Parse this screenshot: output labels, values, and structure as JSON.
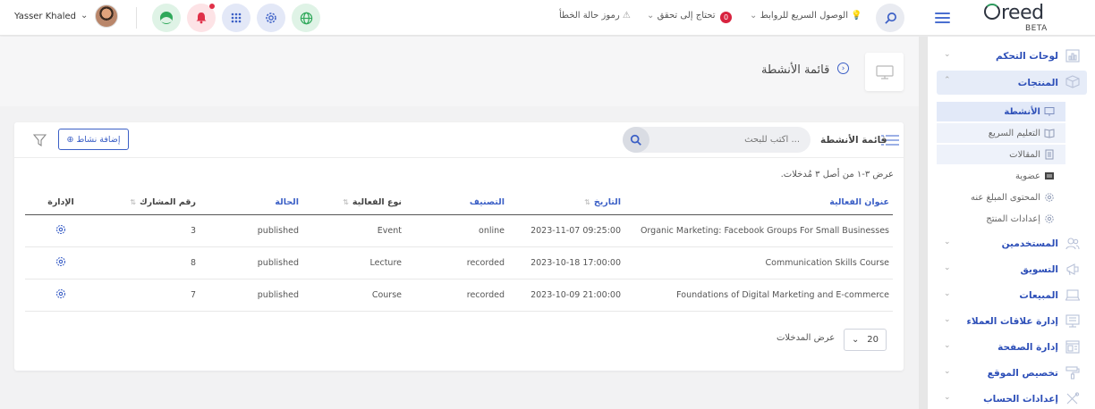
{
  "topbar": {
    "user_name": "Yasser Khaled",
    "quick_access": "الوصول السريع للروابط",
    "needs_check": "تحتاج إلى تحقق",
    "needs_check_count": "0",
    "error_codes": "رموز حالة الخطأ",
    "logo": "reed",
    "logo_badge": "BETA",
    "icons": [
      "green-circle-icon",
      "bell-icon",
      "apps-grid-icon",
      "gear-icon",
      "globe-icon",
      "search-icon",
      "menu-icon"
    ]
  },
  "sidebar": {
    "items": [
      {
        "label": "لوحات التحكم"
      },
      {
        "label": "المنتجات"
      },
      {
        "label": "المستخدمين"
      },
      {
        "label": "التسويق"
      },
      {
        "label": "المبيعات"
      },
      {
        "label": "إدارة علاقات العملاء"
      },
      {
        "label": "إدارة الصفحة"
      },
      {
        "label": "تخصيص الموقع"
      },
      {
        "label": "إعدادات الحساب"
      }
    ],
    "sub_items": [
      {
        "label": "الأنشطة"
      },
      {
        "label": "التعليم السريع"
      },
      {
        "label": "المقالات"
      },
      {
        "label": "عضوية"
      },
      {
        "label": "المحتوى المبلغ عنه"
      },
      {
        "label": "إعدادات المنتج"
      }
    ]
  },
  "page": {
    "title": "قائمة الأنشطة"
  },
  "card": {
    "title": "قائمة الأنشطة",
    "search_placeholder": "اكتب للبحث ...",
    "add_button": "إضافة نشاط",
    "showing_text": "عرض ٣-١ من أصل ٣ مُدخلات."
  },
  "table": {
    "headers": [
      "عنوان الفعالية",
      "التاريخ",
      "التصنيف",
      "نوع الفعالية",
      "الحالة",
      "رقم المشارك",
      "الإدارة"
    ],
    "rows": [
      {
        "title": "Organic Marketing: Facebook Groups For Small Businesses",
        "date": "2023-11-07 09:25:00",
        "category": "online",
        "type": "Event",
        "status": "published",
        "participants": "3"
      },
      {
        "title": "Communication Skills Course",
        "date": "2023-10-18 17:00:00",
        "category": "recorded",
        "type": "Lecture",
        "status": "published",
        "participants": "8"
      },
      {
        "title": "Foundations of Digital Marketing and E-commerce",
        "date": "2023-10-09 21:00:00",
        "category": "recorded",
        "type": "Course",
        "status": "published",
        "participants": "7"
      }
    ]
  },
  "pager": {
    "label": "عرض المدخلات",
    "value": "20"
  },
  "colors": {
    "accent": "#3b5fc6",
    "badge_red": "#d8233f"
  }
}
